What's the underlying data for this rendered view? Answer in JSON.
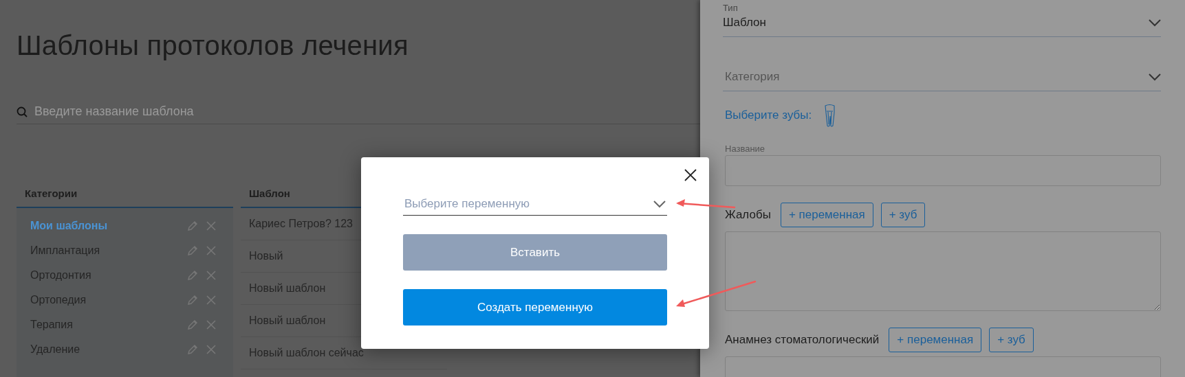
{
  "page": {
    "title": "Шаблоны протоколов лечения",
    "search": {
      "placeholder": "Введите название шаблона"
    }
  },
  "categories": {
    "heading": "Категории",
    "items": [
      {
        "label": "Мои шаблоны",
        "selected": true
      },
      {
        "label": "Имплантация",
        "selected": false
      },
      {
        "label": "Ортодонтия",
        "selected": false
      },
      {
        "label": "Ортопедия",
        "selected": false
      },
      {
        "label": "Терапия",
        "selected": false
      },
      {
        "label": "Удаление",
        "selected": false
      }
    ]
  },
  "templates": {
    "heading": "Шаблон",
    "rows": [
      "Кариес Петров? 123",
      "Новый",
      "Новый шаблон",
      "Новый шаблон",
      "Новый шаблон сейчас"
    ]
  },
  "editor": {
    "type_field": {
      "label": "Тип",
      "value": "Шаблон"
    },
    "category_field": {
      "placeholder": "Категория"
    },
    "teeth_link": "Выберите зубы:",
    "name_field": {
      "label": "Название"
    },
    "sections": [
      {
        "label": "Жалобы",
        "buttons": [
          "+ переменная",
          "+ зуб"
        ]
      },
      {
        "label": "Анамнез стоматологический",
        "buttons": [
          "+ переменная",
          "+ зуб"
        ]
      }
    ]
  },
  "dialog": {
    "select": {
      "placeholder": "Выберите переменную"
    },
    "buttons": [
      {
        "label": "Вставить",
        "disabled": true
      },
      {
        "label": "Создать переменную",
        "disabled": false
      }
    ]
  }
}
